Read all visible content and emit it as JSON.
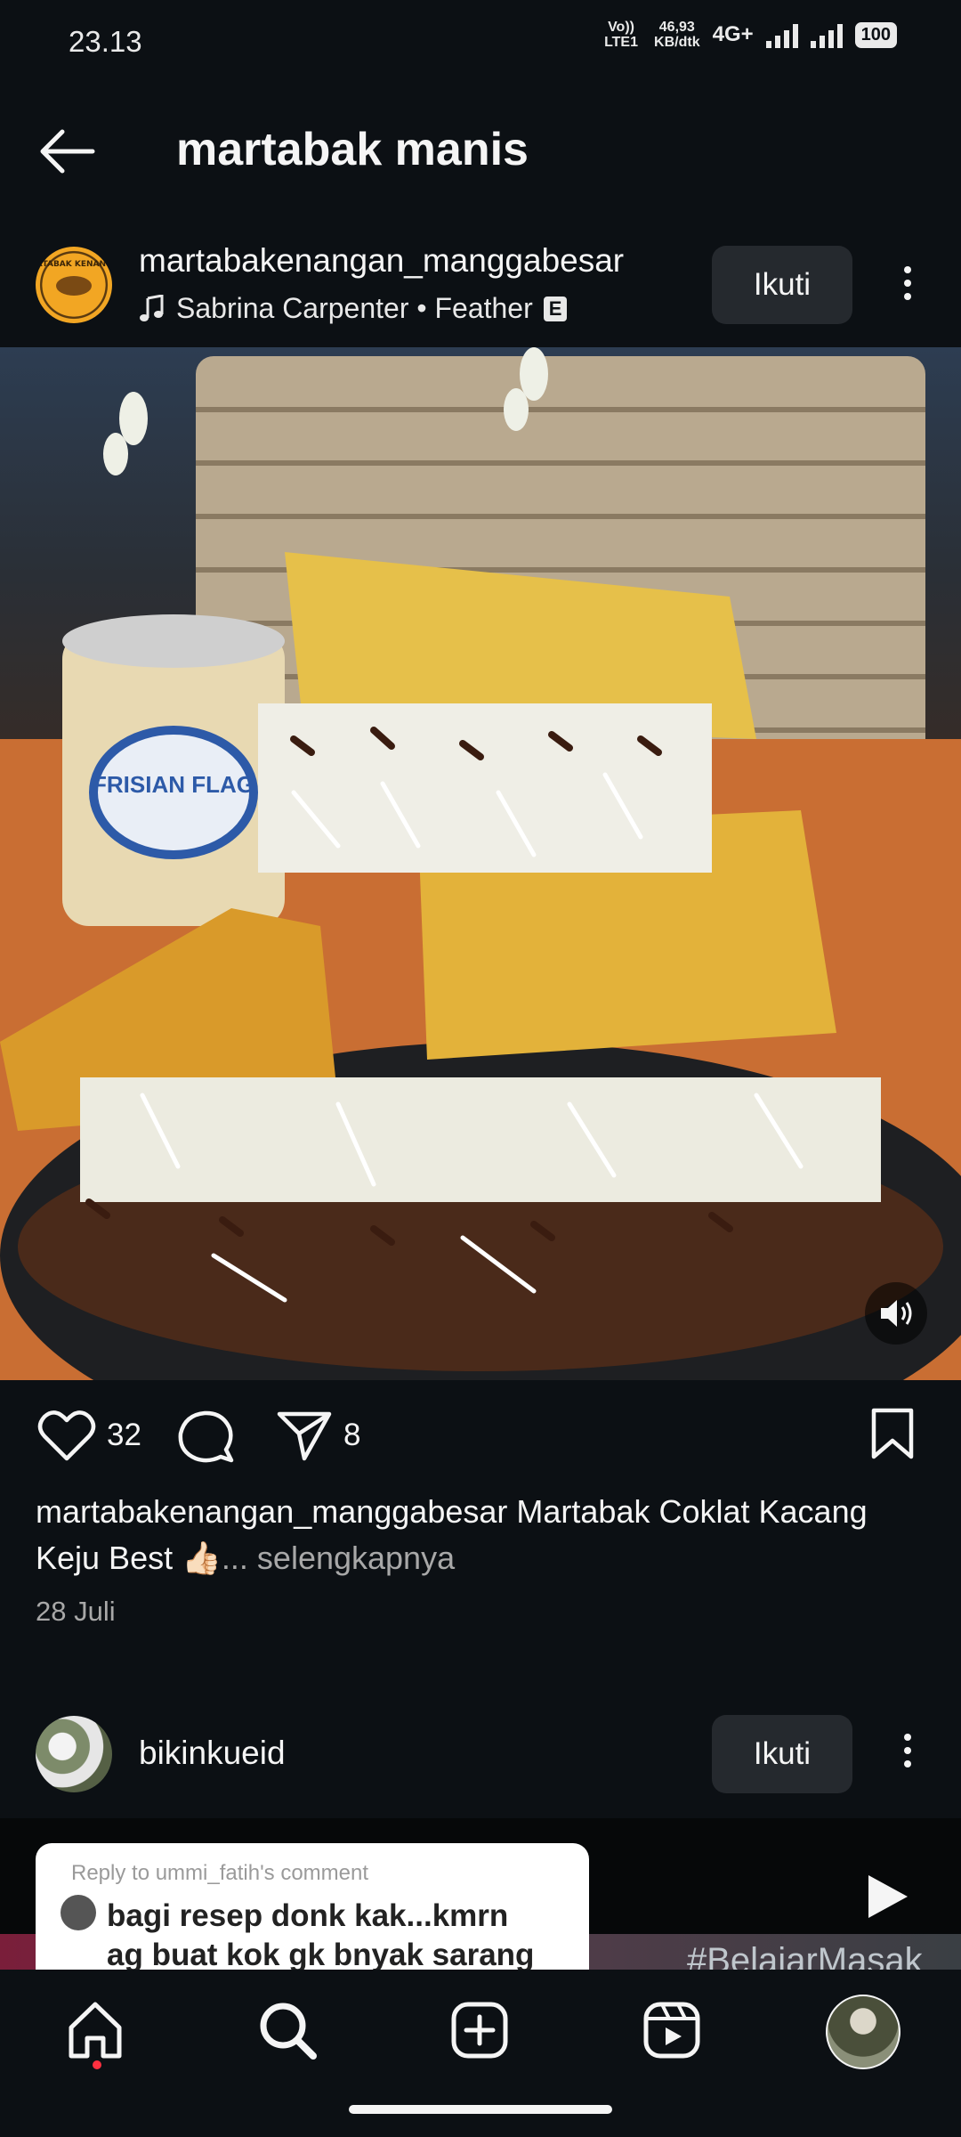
{
  "status_bar": {
    "time": "23.13",
    "volte": "Vo)) LTE1",
    "speed_value": "46,93",
    "speed_unit": "KB/dtk",
    "network": "4G+",
    "battery": "100"
  },
  "header": {
    "title": "martabak manis"
  },
  "post1": {
    "username": "martabakenangan_manggabesar",
    "music": "Sabrina Carpenter • Feather",
    "explicit_badge": "E",
    "follow_label": "Ikuti",
    "logo_text": "MARTABAK KENANGAN",
    "likes": "32",
    "shares": "8",
    "caption_user": "martabakenangan_manggabesar",
    "caption_text": "Martabak Coklat Kacang Keju Best 👍🏻",
    "caption_more": "... selengkapnya",
    "date": "28 Juli",
    "image_text": "FRISIAN FLAG"
  },
  "post2": {
    "username": "bikinkueid",
    "follow_label": "Ikuti",
    "reply_meta": "Reply to ummi_fatih's comment",
    "reply_text_1": "bagi resep donk kak...kmrn",
    "reply_text_2": "ag buat kok gk bnyak sarang",
    "hashtag": "#BelajarMasak"
  },
  "colors": {
    "background": "#0c1014",
    "button": "#25292e",
    "muted_text": "#a8a8a8",
    "notification_dot": "#ff3040"
  },
  "icons": {
    "back": "arrow-left-icon",
    "music": "music-note-icon",
    "like": "heart-icon",
    "comment": "comment-icon",
    "share": "send-icon",
    "save": "bookmark-icon",
    "mute": "volume-icon",
    "play": "play-icon",
    "home": "home-icon",
    "search": "search-icon",
    "create": "plus-square-icon",
    "reels": "reels-icon"
  }
}
